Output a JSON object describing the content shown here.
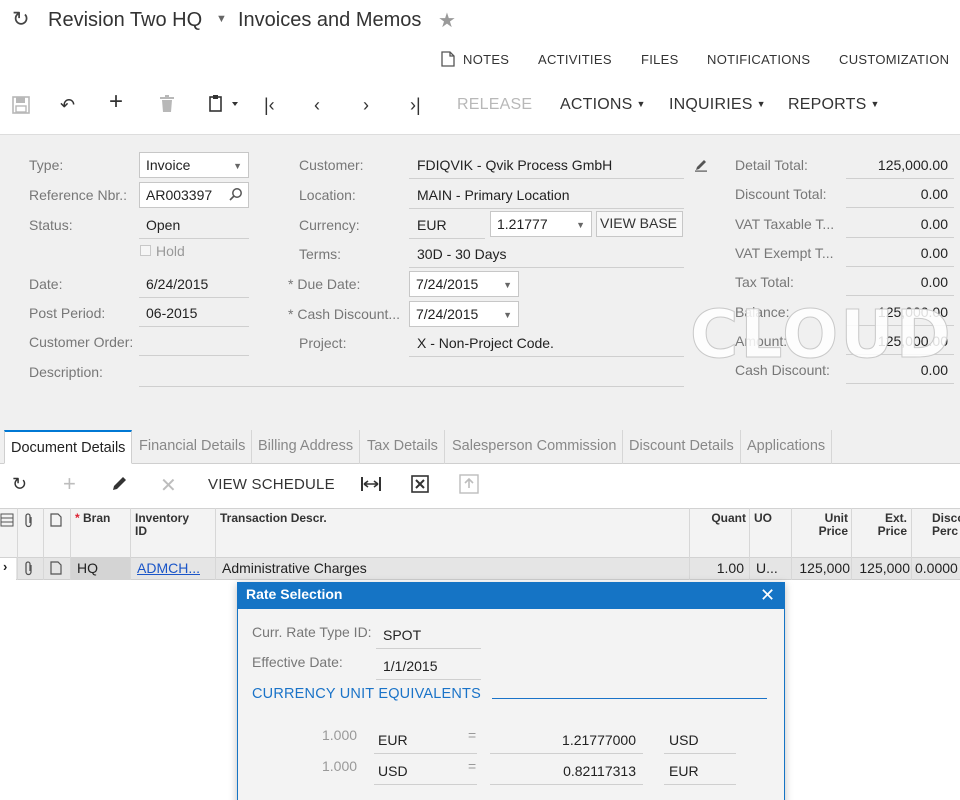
{
  "header": {
    "company": "Revision Two HQ",
    "screen_title": "Invoices and Memos"
  },
  "top_links": [
    "NOTES",
    "ACTIVITIES",
    "FILES",
    "NOTIFICATIONS",
    "CUSTOMIZATION"
  ],
  "toolbar": {
    "release": "RELEASE",
    "actions": "ACTIONS",
    "inquiries": "INQUIRIES",
    "reports": "REPORTS"
  },
  "form": {
    "type_label": "Type:",
    "type_value": "Invoice",
    "refnbr_label": "Reference Nbr.:",
    "refnbr_value": "AR003397",
    "status_label": "Status:",
    "status_value": "Open",
    "hold_label": "Hold",
    "date_label": "Date:",
    "date_value": "6/24/2015",
    "period_label": "Post Period:",
    "period_value": "06-2015",
    "custorder_label": "Customer Order:",
    "custorder_value": "",
    "description_label": "Description:",
    "description_value": "",
    "customer_label": "Customer:",
    "customer_value": "FDIQVIK - Qvik Process GmbH",
    "location_label": "Location:",
    "location_value": "MAIN - Primary Location",
    "currency_label": "Currency:",
    "currency_value": "EUR",
    "rate_value": "1.21777",
    "view_base": "VIEW BASE",
    "terms_label": "Terms:",
    "terms_value": "30D - 30 Days",
    "duedate_label": "Due Date:",
    "duedate_value": "7/24/2015",
    "cashdisc_label": "Cash Discount...",
    "cashdisc_value": "7/24/2015",
    "project_label": "Project:",
    "project_value": "X - Non-Project Code.",
    "required_mark": "*"
  },
  "totals": [
    {
      "label": "Detail Total:",
      "value": "125,000.00"
    },
    {
      "label": "Discount Total:",
      "value": "0.00"
    },
    {
      "label": "VAT Taxable T...",
      "value": "0.00"
    },
    {
      "label": "VAT Exempt T...",
      "value": "0.00"
    },
    {
      "label": "Tax Total:",
      "value": "0.00"
    },
    {
      "label": "Balance:",
      "value": "125,000.00"
    },
    {
      "label": "Amount:",
      "value": "125,000.00"
    },
    {
      "label": "Cash Discount:",
      "value": "0.00"
    }
  ],
  "watermark": "CLOUD",
  "tabs": [
    "Document Details",
    "Financial Details",
    "Billing Address",
    "Tax Details",
    "Salesperson Commission",
    "Discount Details",
    "Applications"
  ],
  "grid_toolbar": {
    "view_schedule": "VIEW SCHEDULE"
  },
  "grid": {
    "headers": {
      "branch": "Bran",
      "inventory_id_1": "Inventory",
      "inventory_id_2": "ID",
      "transaction_descr": "Transaction Descr.",
      "quantity": "Quant",
      "uom": "UO",
      "unit_price_1": "Unit",
      "unit_price_2": "Price",
      "ext_price_1": "Ext.",
      "ext_price_2": "Price",
      "disc_pct_1": "Disco",
      "disc_pct_2": "Perc"
    },
    "row": {
      "branch": "HQ",
      "inventory_id": "ADMCH...",
      "transaction_descr": "Administrative Charges",
      "quantity": "1.00",
      "uom": "U...",
      "unit_price": "125,000",
      "ext_price": "125,000",
      "disc_pct": "0.0000"
    }
  },
  "dialog": {
    "title": "Rate Selection",
    "rate_type_label": "Curr. Rate Type ID:",
    "rate_type_value": "SPOT",
    "effective_date_label": "Effective Date:",
    "effective_date_value": "1/1/2015",
    "section_title": "CURRENCY UNIT EQUIVALENTS",
    "equivalents": [
      {
        "qty": "1.000",
        "from": "EUR",
        "eq": "=",
        "rate": "1.21777000",
        "to": "USD"
      },
      {
        "qty": "1.000",
        "from": "USD",
        "eq": "=",
        "rate": "0.82117313",
        "to": "EUR"
      }
    ]
  }
}
